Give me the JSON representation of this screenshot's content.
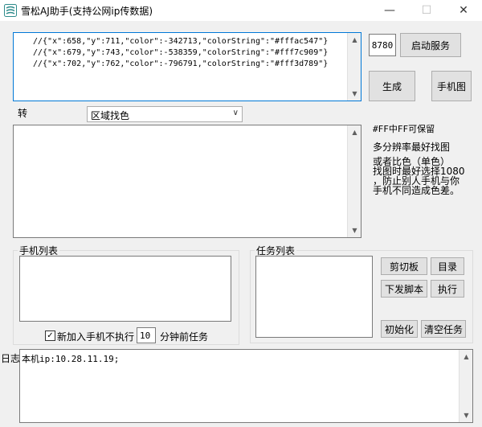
{
  "window": {
    "title": "雪松AJ助手(支持公网ip传数据)",
    "minimize": "—",
    "maximize": "☐",
    "close": "✕"
  },
  "code_lines": [
    "//{\"x\":658,\"y\":711,\"color\":-342713,\"colorString\":\"#fffac547\"}",
    "//{\"x\":679,\"y\":743,\"color\":-538359,\"colorString\":\"#fff7c909\"}",
    "//{\"x\":702,\"y\":762,\"color\":-796791,\"colorString\":\"#fff3d789\"}"
  ],
  "port": {
    "value": "8780"
  },
  "buttons": {
    "start_service": "启动服务",
    "generate": "生成",
    "phone_image": "手机图",
    "clipboard": "剪切板",
    "directory": "目录",
    "send_script": "下发脚本",
    "execute": "执行",
    "initialize": "初始化",
    "clear_tasks": "清空任务"
  },
  "convert": {
    "label": "转",
    "selected": "区域找色"
  },
  "tips": {
    "line1": "#FF中FF可保留",
    "line2": "多分辨率最好找图",
    "line3": "或者比色（单色）",
    "line4": "找图时最好选择1080",
    "line5": "，防止别人手机与你",
    "line6": "手机不同造成色差。"
  },
  "phone_list": {
    "title": "手机列表"
  },
  "task_list": {
    "title": "任务列表"
  },
  "new_phone": {
    "checked": true,
    "check_mark": "✓",
    "label_before": "新加入手机不执行",
    "minutes": "10",
    "label_after": "分钟前任务"
  },
  "log": {
    "label": "日志",
    "text": "本机ip:10.28.11.19;"
  },
  "colors": {
    "accent": "#0078d7",
    "icon": "#2e8b8b"
  }
}
